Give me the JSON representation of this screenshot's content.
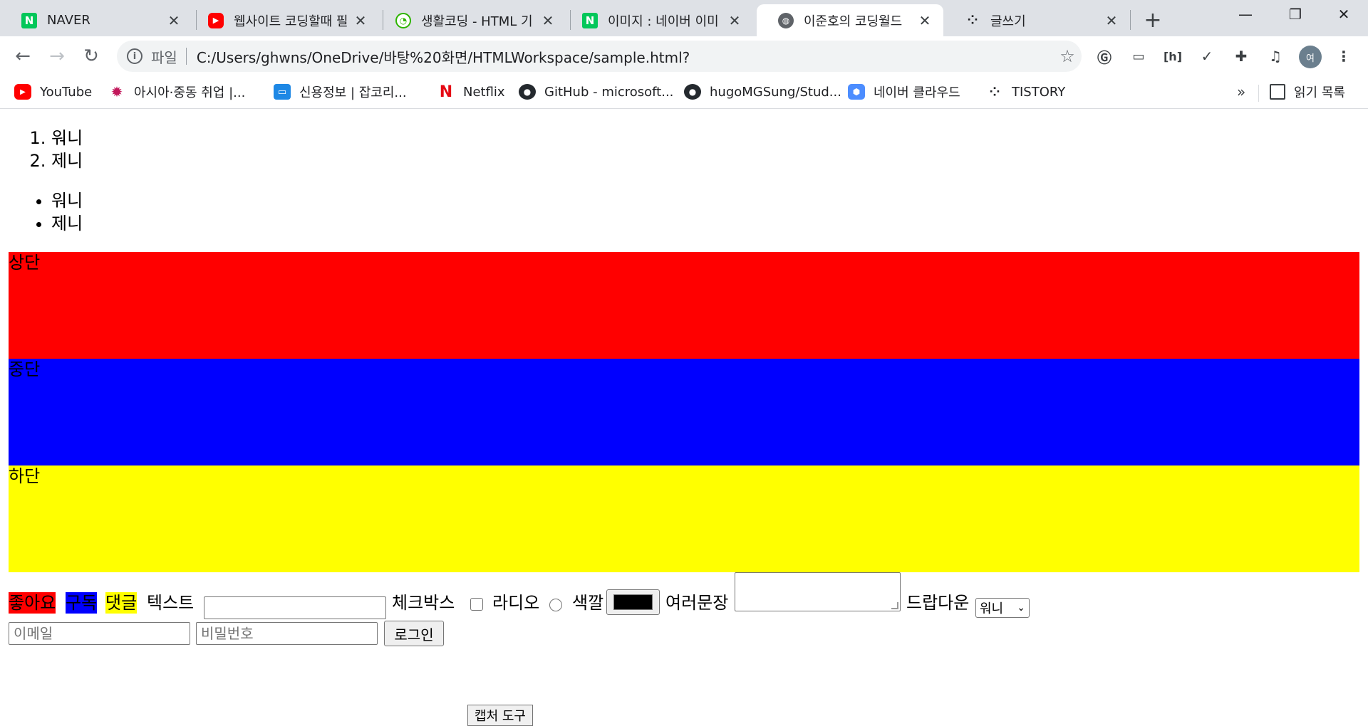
{
  "tabs": [
    {
      "title": "NAVER",
      "icon": "naver-icon",
      "color": "#03c75a",
      "active": false
    },
    {
      "title": "웹사이트 코딩할때 필",
      "icon": "youtube-icon",
      "color": "#ff0000",
      "active": false
    },
    {
      "title": "생활코딩 - HTML 기",
      "icon": "opentutorials-icon",
      "color": "#2db400",
      "active": false
    },
    {
      "title": "이미지 : 네이버 이미",
      "icon": "naver-icon",
      "color": "#03c75a",
      "active": false
    },
    {
      "title": "이준호의 코딩월드",
      "icon": "globe-icon",
      "color": "#5f6368",
      "active": true
    },
    {
      "title": "글쓰기",
      "icon": "tistory-icon",
      "color": "#202124",
      "active": false
    }
  ],
  "toolbar": {
    "scheme": "파일",
    "url": "C:/Users/ghwns/OneDrive/바탕%20화면/HTMLWorkspace/sample.html?",
    "profile": "여"
  },
  "bookmarks": [
    {
      "label": "YouTube",
      "icon": "youtube-icon",
      "color": "#ff0000"
    },
    {
      "label": "아시아·중동 취업 |...",
      "icon": "worknet-icon",
      "color": "#c2185b"
    },
    {
      "label": "신용정보 | 잡코리...",
      "icon": "jobkorea-icon",
      "color": "#1e88e5"
    },
    {
      "label": "Netflix",
      "icon": "netflix-icon",
      "color": "#e50914"
    },
    {
      "label": "GitHub - microsoft...",
      "icon": "github-icon",
      "color": "#24292e"
    },
    {
      "label": "hugoMGSung/Stud...",
      "icon": "github-icon",
      "color": "#24292e"
    },
    {
      "label": "네이버 클라우드",
      "icon": "naver-cloud-icon",
      "color": "#4c8dff"
    },
    {
      "label": "TISTORY",
      "icon": "tistory-icon",
      "color": "#202124"
    }
  ],
  "reading_list": "읽기 목록",
  "content": {
    "ordered": [
      "워니",
      "제니"
    ],
    "unordered": [
      "워니",
      "제니"
    ],
    "sections": [
      {
        "label": "상단",
        "color": "#ff0000"
      },
      {
        "label": "중단",
        "color": "#0000ff"
      },
      {
        "label": "하단",
        "color": "#ffff00"
      }
    ],
    "like": {
      "label": "좋아요",
      "color": "#ff0000"
    },
    "subscribe": {
      "label": "구독",
      "color": "#0000ff"
    },
    "comment": {
      "label": "댓글",
      "color": "#ffff00"
    },
    "text_label": "텍스트",
    "checkbox_label": "체크박스",
    "radio_label": "라디오",
    "color_label": "색깔",
    "color_value": "#000000",
    "textarea_label": "여러문장",
    "dropdown_label": "드랍다운",
    "dropdown_value": "워니",
    "email_placeholder": "이메일",
    "password_placeholder": "비밀번호",
    "login_button": "로그인",
    "capture_tool": "캡처 도구"
  }
}
